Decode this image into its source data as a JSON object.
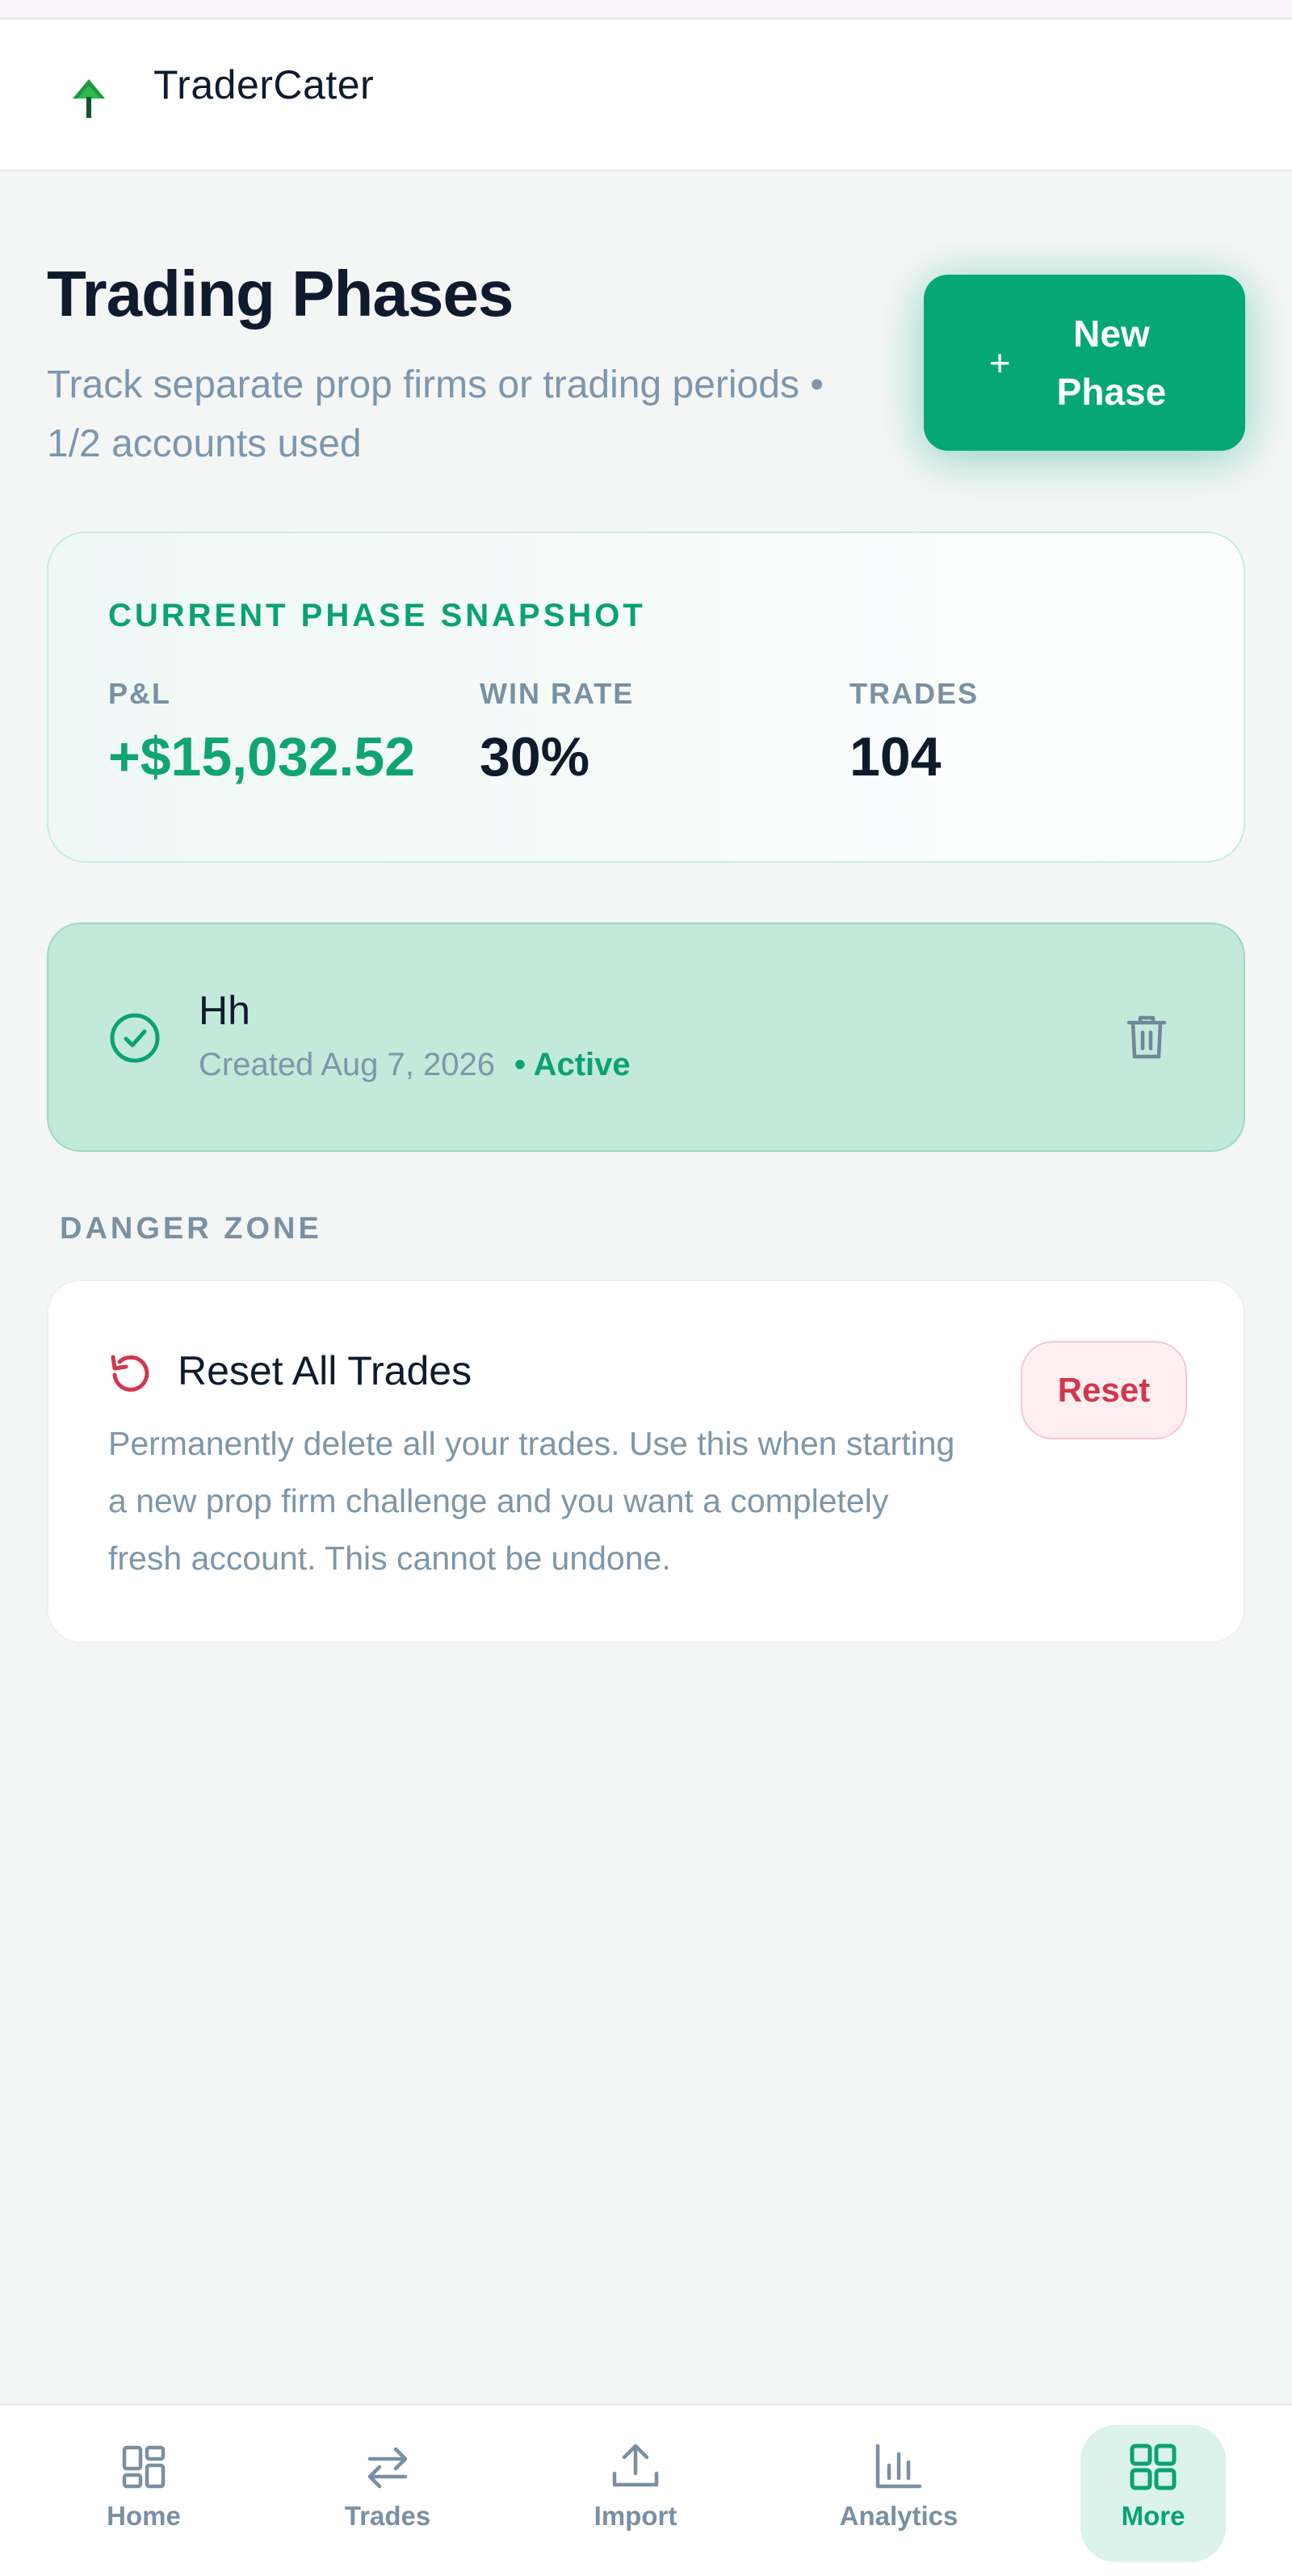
{
  "app": {
    "brand": "TraderCater"
  },
  "page": {
    "title": "Trading Phases",
    "subtitle": "Track separate prop firms or trading periods • 1/2 accounts used",
    "new_phase_plus": "+",
    "new_phase_label": "New Phase"
  },
  "snapshot": {
    "title": "CURRENT PHASE SNAPSHOT",
    "stats": [
      {
        "label": "P&L",
        "value": "+$15,032.52"
      },
      {
        "label": "WIN RATE",
        "value": "30%"
      },
      {
        "label": "TRADES",
        "value": "104"
      }
    ]
  },
  "phase": {
    "name": "Hh",
    "created": "Created Aug 7, 2026",
    "status": "• Active"
  },
  "danger_zone": {
    "label": "DANGER ZONE",
    "reset_title": "Reset All Trades",
    "reset_description": "Permanently delete all your trades. Use this when starting a new prop firm challenge and you want a completely fresh account. This cannot be undone.",
    "reset_button": "Reset"
  },
  "nav": {
    "items": [
      {
        "label": "Home",
        "icon": "home-grid-icon"
      },
      {
        "label": "Trades",
        "icon": "arrows-swap-icon"
      },
      {
        "label": "Import",
        "icon": "upload-icon"
      },
      {
        "label": "Analytics",
        "icon": "bar-chart-icon"
      },
      {
        "label": "More",
        "icon": "grid-icon",
        "active": true
      }
    ]
  },
  "colors": {
    "accent": "#06a776",
    "danger": "#d2374d",
    "muted": "#7e96a8"
  }
}
